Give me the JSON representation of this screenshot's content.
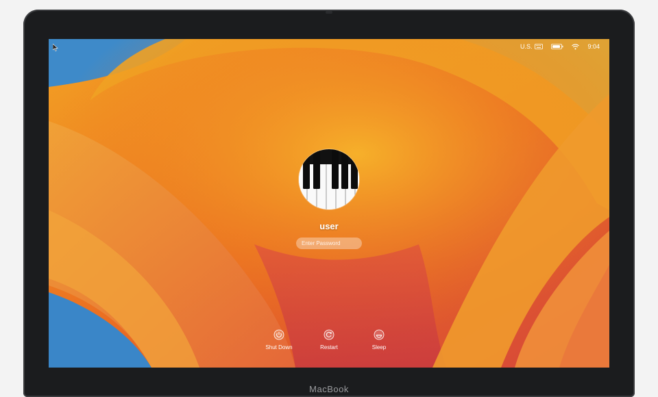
{
  "menubar": {
    "input_source": "U.S.",
    "time": "9:04"
  },
  "login": {
    "username": "user",
    "password_placeholder": "Enter Password"
  },
  "actions": [
    {
      "label": "Shut Down",
      "icon": "power-icon"
    },
    {
      "label": "Restart",
      "icon": "restart-icon"
    },
    {
      "label": "Sleep",
      "icon": "sleep-icon"
    }
  ],
  "device": {
    "brand": "MacBook"
  },
  "colors": {
    "wallpaper_orange": "#f0a020",
    "wallpaper_red": "#d8503a",
    "wallpaper_blue": "#3d86c6"
  }
}
